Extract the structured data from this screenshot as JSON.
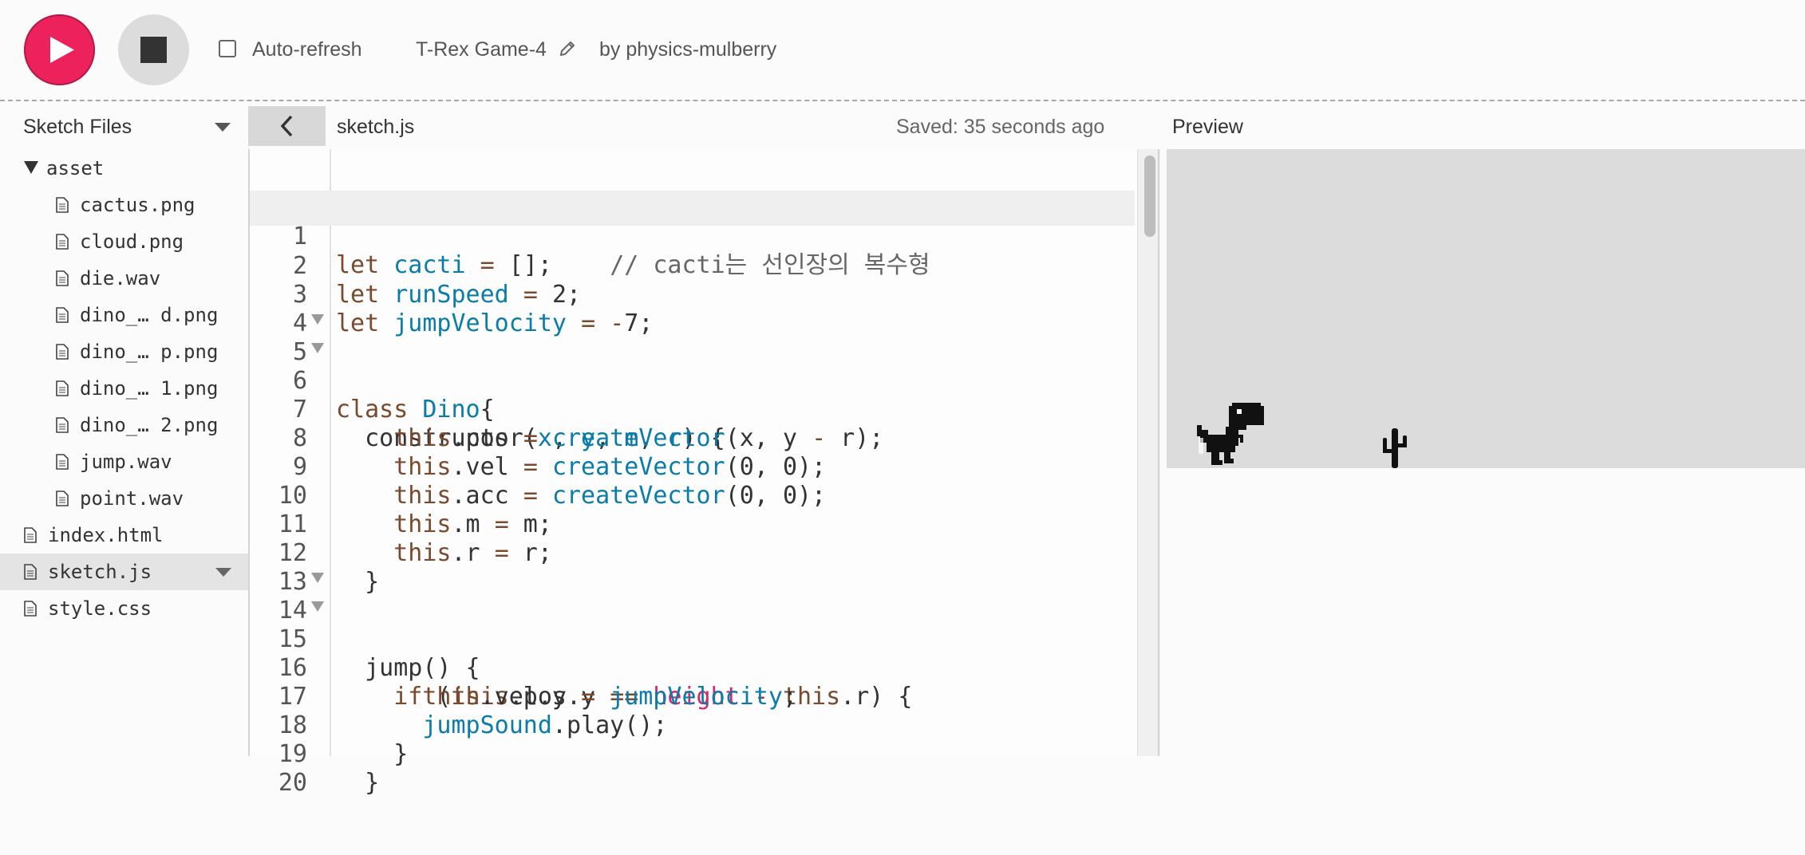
{
  "toolbar": {
    "play_icon": "play-icon",
    "stop_icon": "stop-icon",
    "auto_refresh_label": "Auto-refresh",
    "auto_refresh_checked": false,
    "sketch_title": "T-Rex Game-4",
    "author": "by physics-mulberry",
    "accent_color": "#ed225d"
  },
  "subbar": {
    "files_label": "Sketch Files",
    "active_file": "sketch.js",
    "save_status": "Saved: 35 seconds ago",
    "preview_label": "Preview"
  },
  "sidebar": {
    "folder": "asset",
    "asset_files": [
      "cactus.png",
      "cloud.png",
      "die.wav",
      "dino_… d.png",
      "dino_… p.png",
      "dino_… 1.png",
      "dino_… 2.png",
      "jump.wav",
      "point.wav"
    ],
    "root_files": [
      "index.html",
      "sketch.js",
      "style.css"
    ],
    "selected_file": "sketch.js"
  },
  "editor": {
    "line_numbers": [
      "1",
      "2",
      "3",
      "4",
      "5",
      "6",
      "7",
      "8",
      "9",
      "10",
      "11",
      "12",
      "13",
      "14",
      "15",
      "16",
      "17",
      "18",
      "19",
      "20"
    ],
    "lines": [
      "let cacti = [];    // cacti는 선인장의 복수형",
      "let runSpeed = 2;",
      "let jumpVelocity = -7;",
      "",
      "class Dino{",
      "  constructor(x, y, m, r) {",
      "    this.pos = createVector(x, y - r);",
      "    this.vel = createVector(0, 0);",
      "    this.acc = createVector(0, 0);",
      "    this.m = m;",
      "    this.r = r;",
      "  }",
      "",
      "  jump() {",
      "    if (this.pos.y == height - this.r) {",
      "      this.vel.y = jumpVelocity;",
      "      jumpSound.play();",
      "    }",
      "  }",
      ""
    ],
    "fold_lines": [
      "5",
      "6",
      "14",
      "15"
    ]
  },
  "preview": {
    "canvas_color": "#dcdcdc",
    "sprites": [
      "dino-sprite",
      "cactus-sprite"
    ]
  }
}
